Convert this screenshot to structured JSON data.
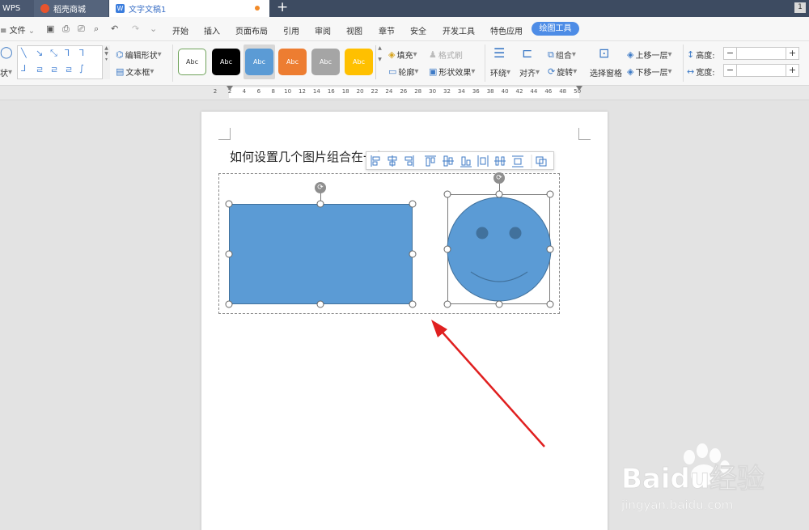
{
  "tabs": {
    "wps": "WPS",
    "shop": "稻壳商城",
    "doc": "文字文稿1",
    "new_tab": "+",
    "window_badge": "1"
  },
  "menu": {
    "file": "文件",
    "items": [
      "开始",
      "插入",
      "页面布局",
      "引用",
      "审阅",
      "视图",
      "章节",
      "安全",
      "开发工具",
      "特色应用"
    ],
    "active": "绘图工具"
  },
  "ribbon": {
    "shape_label": "状",
    "edit_shape": "编辑形状",
    "text_box": "文本框",
    "style_sample": "Abc",
    "fill": "填充",
    "outline": "轮廓",
    "format_painter": "格式刷",
    "shape_effects": "形状效果",
    "wrap": "环绕",
    "align": "对齐",
    "group": "组合",
    "rotate": "旋转",
    "selection_pane": "选择窗格",
    "bring_forward": "上移一层",
    "send_backward": "下移一层",
    "height_label": "高度:",
    "width_label": "宽度:",
    "height_value": "",
    "width_value": ""
  },
  "ruler": {
    "ticks": [
      "2",
      "2",
      "4",
      "6",
      "8",
      "10",
      "12",
      "14",
      "16",
      "18",
      "20",
      "22",
      "24",
      "26",
      "28",
      "30",
      "32",
      "34",
      "36",
      "38",
      "40",
      "42",
      "44",
      "46",
      "48",
      "50"
    ]
  },
  "document": {
    "text": "如何设置几个图片组合在一起？"
  },
  "watermark": {
    "brand": "Baidu经验",
    "url": "jingyan.baidu.com"
  },
  "colors": {
    "accent": "#4d8ce6",
    "shape_fill": "#5b9bd5",
    "arrow": "#e02020",
    "tabbar": "#3d4b61"
  }
}
